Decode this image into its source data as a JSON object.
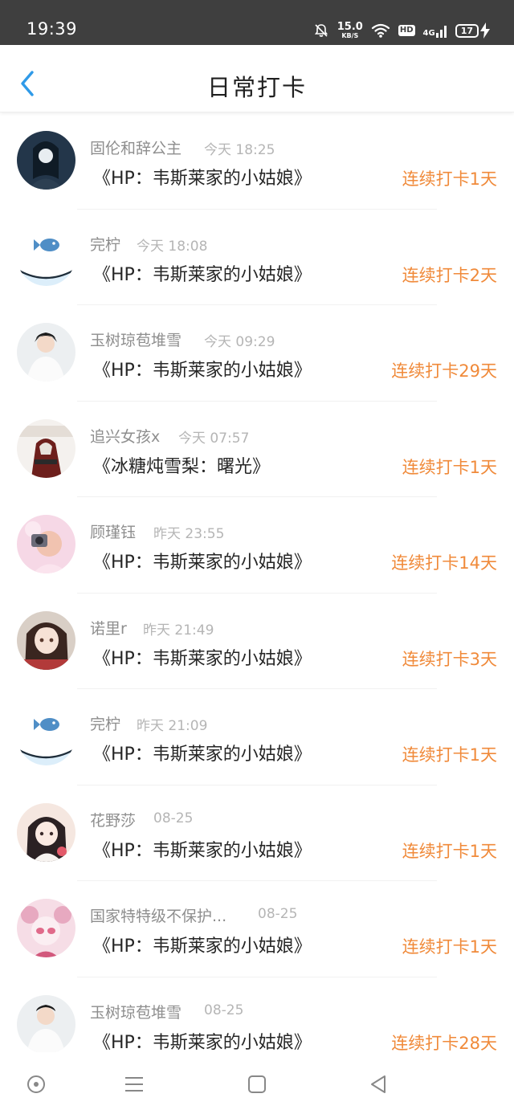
{
  "status_bar": {
    "time": "19:39",
    "net_speed_value": "15.0",
    "net_speed_unit": "KB/S",
    "hd_label": "HD",
    "signal_label": "4G",
    "battery_level": "17",
    "icons": [
      "mute-bell-icon",
      "wifi-icon",
      "signal-icon",
      "battery-icon",
      "charging-icon"
    ]
  },
  "header": {
    "title": "日常打卡",
    "back_icon": "chevron-left-icon",
    "accent_color": "#2f9ae8"
  },
  "colors": {
    "streak": "#f08a3a",
    "name": "#8e8e8e",
    "time": "#b5b5b5",
    "book": "#262626"
  },
  "checkins": [
    {
      "user": "固伦和辞公主",
      "time": "今天 18:25",
      "book": "《HP：韦斯莱家的小姑娘》",
      "streak": "连续打卡1天",
      "avatar": "avatar-dark-anime"
    },
    {
      "user": "完柠",
      "time": "今天 18:08",
      "book": "《HP：韦斯莱家的小姑娘》",
      "streak": "连续打卡2天",
      "avatar": "avatar-fish"
    },
    {
      "user": "玉树琼苞堆雪",
      "time": "今天 09:29",
      "book": "《HP：韦斯莱家的小姑娘》",
      "streak": "连续打卡29天",
      "avatar": "avatar-girl-white"
    },
    {
      "user": "追兴女孩x",
      "time": "今天 07:57",
      "book": "《冰糖炖雪梨：曙光》",
      "streak": "连续打卡1天",
      "avatar": "avatar-assassin"
    },
    {
      "user": "顾瑾钰",
      "time": "昨天 23:55",
      "book": "《HP：韦斯莱家的小姑娘》",
      "streak": "连续打卡14天",
      "avatar": "avatar-pink-camera"
    },
    {
      "user": "诺里r",
      "time": "昨天 21:49",
      "book": "《HP：韦斯莱家的小姑娘》",
      "streak": "连续打卡3天",
      "avatar": "avatar-anime-girl"
    },
    {
      "user": "完柠",
      "time": "昨天 21:09",
      "book": "《HP：韦斯莱家的小姑娘》",
      "streak": "连续打卡1天",
      "avatar": "avatar-fish"
    },
    {
      "user": "花野莎",
      "time": "08-25",
      "book": "《HP：韦斯莱家的小姑娘》",
      "streak": "连续打卡1天",
      "avatar": "avatar-anime-girl-2"
    },
    {
      "user": "国家特特级不保护...",
      "time": "08-25",
      "book": "《HP：韦斯莱家的小姑娘》",
      "streak": "连续打卡1天",
      "avatar": "avatar-sailor"
    },
    {
      "user": "玉树琼苞堆雪",
      "time": "08-25",
      "book": "《HP：韦斯莱家的小姑娘》",
      "streak": "连续打卡28天",
      "avatar": "avatar-girl-white"
    }
  ],
  "nav_bar": {
    "icons": [
      "home-circle-icon",
      "menu-icon",
      "recents-square-icon",
      "back-triangle-icon"
    ]
  }
}
